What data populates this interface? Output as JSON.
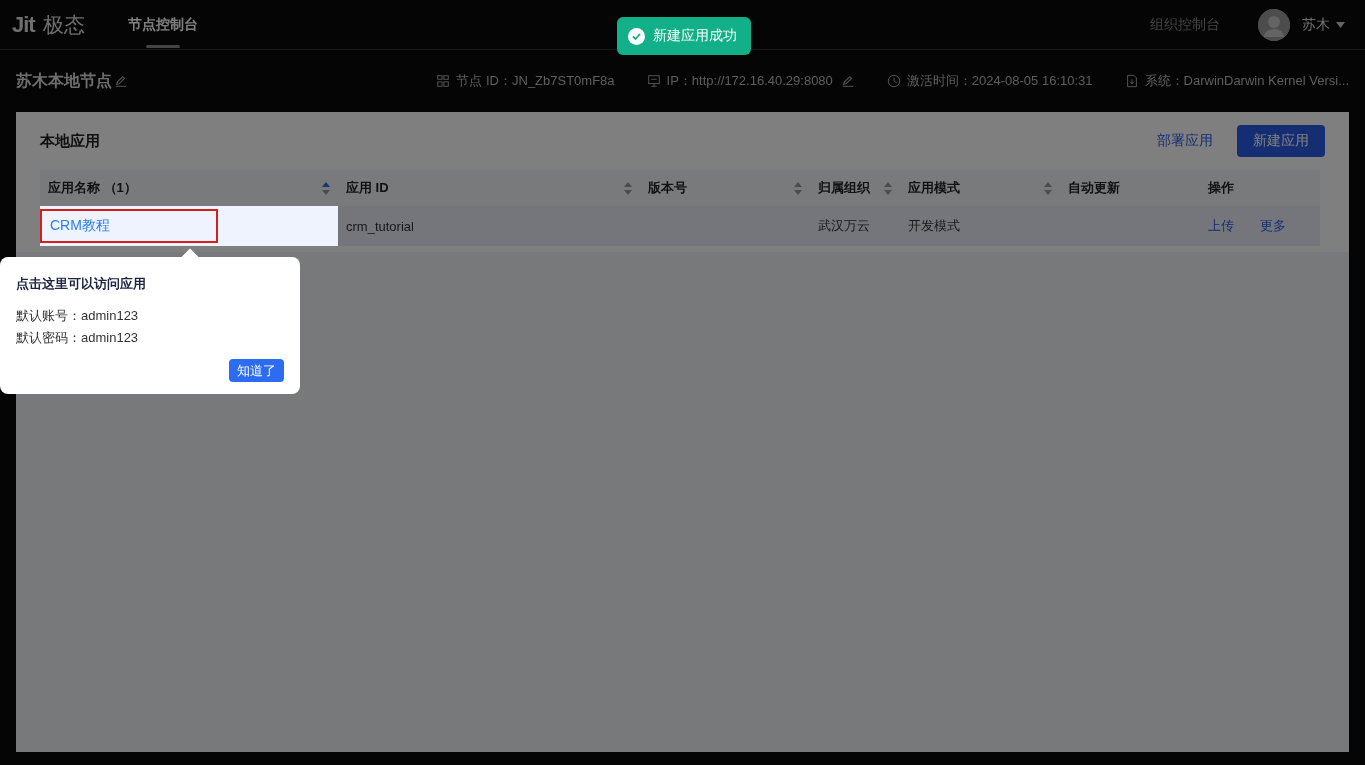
{
  "header": {
    "logo_mark": "Jit",
    "logo_text": "极态",
    "tabs": [
      {
        "label": "节点控制台",
        "selected": true
      }
    ],
    "org_console": "组织控制台",
    "user": {
      "name": "苏木"
    }
  },
  "toast": {
    "message": "新建应用成功"
  },
  "node": {
    "title": "苏木本地节点",
    "info": [
      {
        "kind": "node",
        "label": "节点 ID：",
        "value": "JN_Zb7ST0mF8a"
      },
      {
        "kind": "ip",
        "label": "IP：",
        "value": "http://172.16.40.29:8080"
      },
      {
        "kind": "time",
        "label": "激活时间：",
        "value": "2024-08-05 16:10:31"
      },
      {
        "kind": "system",
        "label": "系统：",
        "value": "DarwinDarwin Kernel Versi..."
      }
    ]
  },
  "card": {
    "title": "本地应用",
    "deploy_link": "部署应用",
    "create_button": "新建应用"
  },
  "table": {
    "columns": [
      {
        "label": "应用名称 （1）",
        "sort_ascending": true
      },
      {
        "label": "应用 ID",
        "sort_ascending": false
      },
      {
        "label": "版本号",
        "sort_ascending": false
      },
      {
        "label": "归属组织",
        "sort_ascending": false
      },
      {
        "label": "应用模式",
        "sort_ascending": false
      },
      {
        "label": "自动更新"
      },
      {
        "label": "操作"
      }
    ],
    "rows": [
      {
        "highlighted": true,
        "cells": [
          "CRM教程",
          "crm_tutorial",
          "",
          "武汉万云",
          "开发模式",
          ""
        ],
        "actions": [
          "上传",
          "更多"
        ]
      }
    ]
  },
  "guide": {
    "title": "点击这里可以访问应用",
    "lines": [
      "默认账号：admin123",
      "默认密码：admin123"
    ],
    "button": "知道了"
  }
}
